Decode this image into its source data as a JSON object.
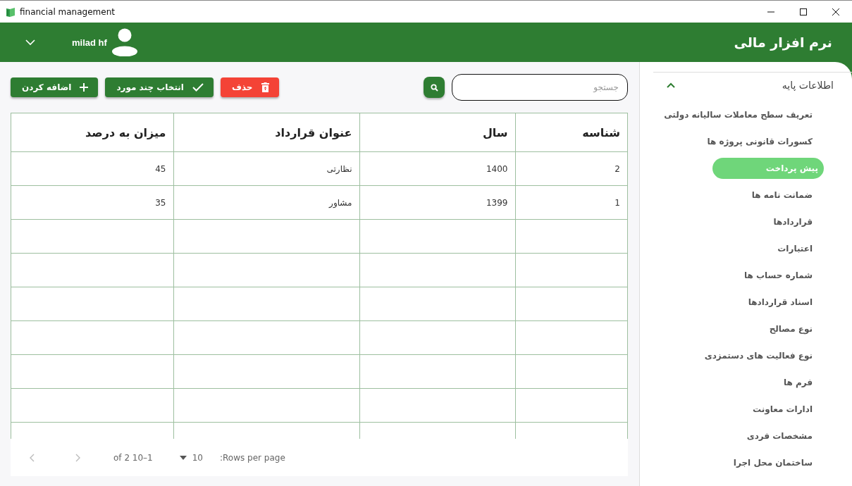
{
  "window": {
    "title": "financial management"
  },
  "header": {
    "app_title": "نرم افزار مالی",
    "user_name": "milad hf"
  },
  "sidebar": {
    "section": {
      "label": "اطلاعات پایه",
      "expanded": true
    },
    "items": [
      {
        "label": "تعریف سطح معاملات سالیانه دولتی",
        "selected": false
      },
      {
        "label": "کسورات قانونی پروژه ها",
        "selected": false
      },
      {
        "label": "پیش پرداخت",
        "selected": true
      },
      {
        "label": "ضمانت نامه ها",
        "selected": false
      },
      {
        "label": "قراردادها",
        "selected": false
      },
      {
        "label": "اعتبارات",
        "selected": false
      },
      {
        "label": "شماره حساب ها",
        "selected": false
      },
      {
        "label": "اسناد قراردادها",
        "selected": false
      },
      {
        "label": "نوع مصالح",
        "selected": false
      },
      {
        "label": "نوع فعالیت های دستمزدی",
        "selected": false
      },
      {
        "label": "فرم ها",
        "selected": false
      },
      {
        "label": "ادارات معاونت",
        "selected": false
      },
      {
        "label": "مشخصات فردی",
        "selected": false
      },
      {
        "label": "ساختمان محل اجرا",
        "selected": false
      }
    ]
  },
  "toolbar": {
    "buttons": [
      {
        "kind": "delete",
        "label": "حذف"
      },
      {
        "kind": "select",
        "label": "انتخاب چند مورد"
      },
      {
        "kind": "add",
        "label": "اضافه کردن"
      }
    ],
    "search": {
      "placeholder": "جستجو"
    }
  },
  "table": {
    "columns": [
      "شناسه",
      "سال",
      "عنوان قرارداد",
      "میزان به درصد"
    ],
    "rows": [
      [
        "2",
        "1400",
        "نظارتی",
        "45"
      ],
      [
        "1",
        "1399",
        "مشاور",
        "35"
      ]
    ]
  },
  "pagination": {
    "rows_per_page_label": ":Rows per page",
    "rows_per_page": "10",
    "range": "of 2 10–1"
  }
}
